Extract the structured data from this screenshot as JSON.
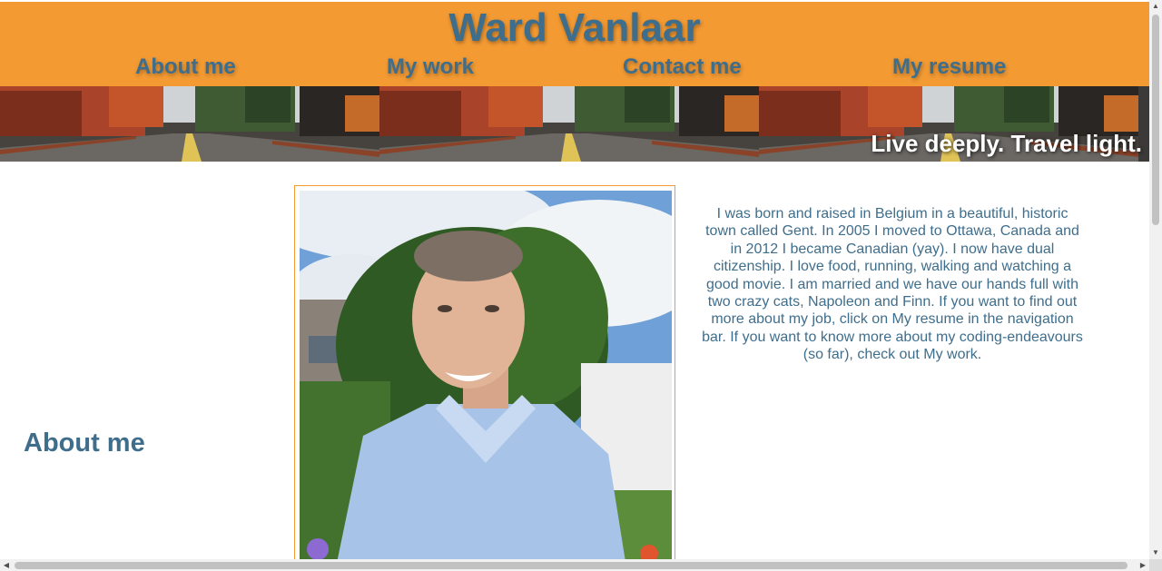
{
  "header": {
    "title": "Ward Vanlaar",
    "background_color": "#f39a33",
    "text_color": "#3f6e8c"
  },
  "nav": {
    "items": [
      {
        "label": "About me"
      },
      {
        "label": "My work"
      },
      {
        "label": "Contact me"
      },
      {
        "label": "My resume"
      }
    ]
  },
  "banner": {
    "tagline": "Live deeply. Travel light.",
    "image": "autumn-road-photo"
  },
  "main": {
    "section_heading": "About me",
    "portrait_image": "profile-photo",
    "bio": "I was born and raised in Belgium in a beautiful, historic town called Gent. In 2005 I moved to Ottawa, Canada and in 2012 I became Canadian (yay). I now have dual citizenship. I love food, running, walking and watching a good movie. I am married and we have our hands full with two crazy cats, Napoleon and Finn. If you want to find out more about my job, click on My resume in the navigation bar. If you want to know more about my coding-endeavours (so far), check out My work."
  }
}
